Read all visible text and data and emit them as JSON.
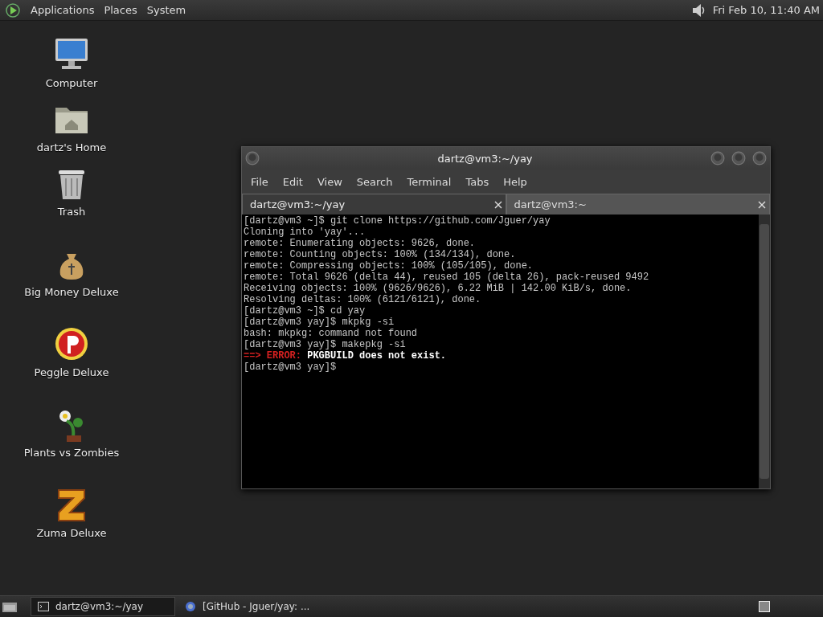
{
  "top_panel": {
    "menus": [
      "Applications",
      "Places",
      "System"
    ],
    "clock": "Fri Feb 10, 11:40 AM"
  },
  "desktop_icons": [
    {
      "label": "Computer",
      "kind": "computer"
    },
    {
      "label": "dartz's Home",
      "kind": "folder"
    },
    {
      "label": "Trash",
      "kind": "trash"
    },
    {
      "label": "Big Money Deluxe",
      "kind": "moneybag"
    },
    {
      "label": "Peggle Deluxe",
      "kind": "peggle"
    },
    {
      "label": "Plants vs Zombies",
      "kind": "plant"
    },
    {
      "label": "Zuma Deluxe",
      "kind": "zuma"
    }
  ],
  "terminal_window": {
    "title": "dartz@vm3:~/yay",
    "menu": [
      "File",
      "Edit",
      "View",
      "Search",
      "Terminal",
      "Tabs",
      "Help"
    ],
    "tabs": [
      {
        "label": "dartz@vm3:~/yay",
        "selected": true
      },
      {
        "label": "dartz@vm3:~",
        "selected": false
      }
    ],
    "lines": [
      [
        {
          "text": "[dartz@vm3 ~]$ git clone https://github.com/Jguer/yay",
          "kind": "normal"
        }
      ],
      [
        {
          "text": "Cloning into 'yay'...",
          "kind": "normal"
        }
      ],
      [
        {
          "text": "remote: Enumerating objects: 9626, done.",
          "kind": "normal"
        }
      ],
      [
        {
          "text": "remote: Counting objects: 100% (134/134), done.",
          "kind": "normal"
        }
      ],
      [
        {
          "text": "remote: Compressing objects: 100% (105/105), done.",
          "kind": "normal"
        }
      ],
      [
        {
          "text": "remote: Total 9626 (delta 44), reused 105 (delta 26), pack-reused 9492",
          "kind": "normal"
        }
      ],
      [
        {
          "text": "Receiving objects: 100% (9626/9626), 6.22 MiB | 142.00 KiB/s, done.",
          "kind": "normal"
        }
      ],
      [
        {
          "text": "Resolving deltas: 100% (6121/6121), done.",
          "kind": "normal"
        }
      ],
      [
        {
          "text": "[dartz@vm3 ~]$ cd yay",
          "kind": "normal"
        }
      ],
      [
        {
          "text": "[dartz@vm3 yay]$ mkpkg -si",
          "kind": "normal"
        }
      ],
      [
        {
          "text": "bash: mkpkg: command not found",
          "kind": "normal"
        }
      ],
      [
        {
          "text": "[dartz@vm3 yay]$ makepkg -si",
          "kind": "normal"
        }
      ],
      [
        {
          "text": "==> ERROR:",
          "kind": "error"
        },
        {
          "text": " PKGBUILD does not exist.",
          "kind": "bold"
        }
      ],
      [
        {
          "text": "[dartz@vm3 yay]$",
          "kind": "normal"
        }
      ]
    ]
  },
  "taskbar": [
    {
      "label": "dartz@vm3:~/yay",
      "kind": "terminal",
      "selected": true
    },
    {
      "label": "[GitHub - Jguer/yay: ...",
      "kind": "browser",
      "selected": false
    }
  ]
}
